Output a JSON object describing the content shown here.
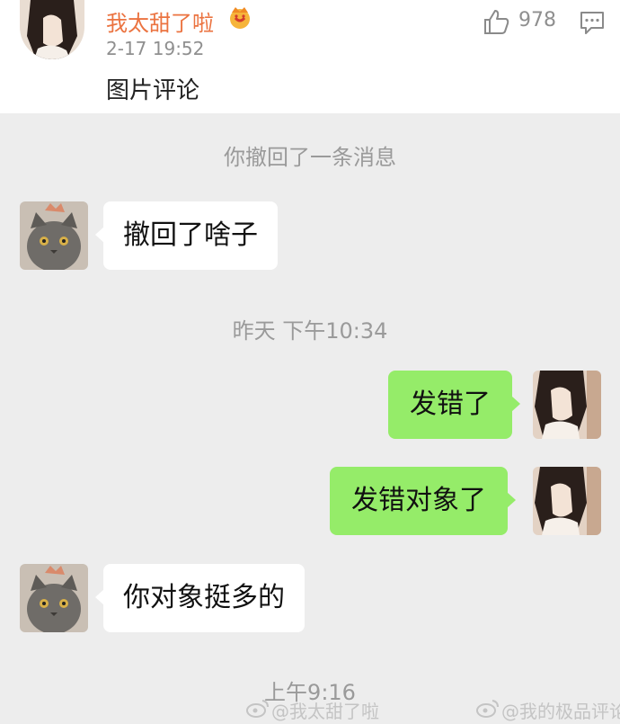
{
  "comment": {
    "username": "我太甜了啦",
    "timestamp": "2-17 19:52",
    "like_count": "978",
    "text": "图片评论"
  },
  "chat": {
    "recall_notice": "你撤回了一条消息",
    "time_1": "昨天 下午10:34",
    "time_2": "上午9:16",
    "messages": [
      {
        "side": "left",
        "text": "撤回了啥子"
      },
      {
        "side": "right",
        "text": "发错了"
      },
      {
        "side": "right",
        "text": "发错对象了"
      },
      {
        "side": "left",
        "text": "你对象挺多的"
      }
    ]
  },
  "watermark": {
    "left": "@我太甜了啦",
    "right": "@我的极品评论"
  },
  "colors": {
    "username": "#eb7340",
    "bubble_sent": "#95ec69",
    "bubble_received": "#ffffff",
    "chat_background": "#ededed"
  },
  "icons": [
    "crown-badge-icon",
    "thumbs-up-icon",
    "reply-icon",
    "weibo-logo-icon"
  ]
}
